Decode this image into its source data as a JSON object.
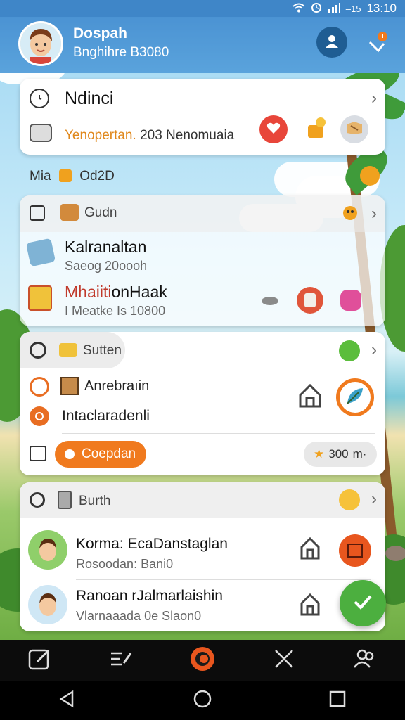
{
  "status_bar": {
    "time": "13:10",
    "signal_text": "–15"
  },
  "header": {
    "name": "Dospah",
    "subtitle": "Bnghihre B3080"
  },
  "card_top": {
    "title": "Ndinci",
    "subtitle_left": "Yenopertan.",
    "subtitle_right": "203 Nenomuaia"
  },
  "mid_label": {
    "left": "Mia",
    "right": "Od2D"
  },
  "card_gudn": {
    "header": "Gudn",
    "item1_title": "Kalranaltan",
    "item1_sub": "Saeog 20oooh",
    "item2_title": "Mhaiiti",
    "item2_title_b": "onHaak",
    "item2_sub": "I Meatke Is 10800"
  },
  "card_sutten": {
    "header": "Sutten",
    "item1": "Anrebraıin",
    "item2": "Intaclaradenli",
    "button": "Coepdan",
    "score": "300",
    "score_suffix": "m·"
  },
  "card_burth": {
    "header": "Burth",
    "person1_name": "Korma: EcaDanstaglan",
    "person1_sub": "Rosoodan: Bani0",
    "person2_name": "Ranoan rJalmarlaishin",
    "person2_sub": "Vlarnaaada 0e Slaon0"
  },
  "colors": {
    "header": "#4b93d3",
    "accent": "#f07a1e",
    "fab": "#4caf3f",
    "heart": "#e8463a"
  },
  "icons": [
    "wifi-icon",
    "alarm-icon",
    "signal-icon",
    "profile-icon",
    "bell-icon",
    "clock-icon",
    "keyboard-icon",
    "heart-icon",
    "chevron-right-icon",
    "check-icon",
    "edit-icon",
    "home-icon",
    "back-icon"
  ]
}
